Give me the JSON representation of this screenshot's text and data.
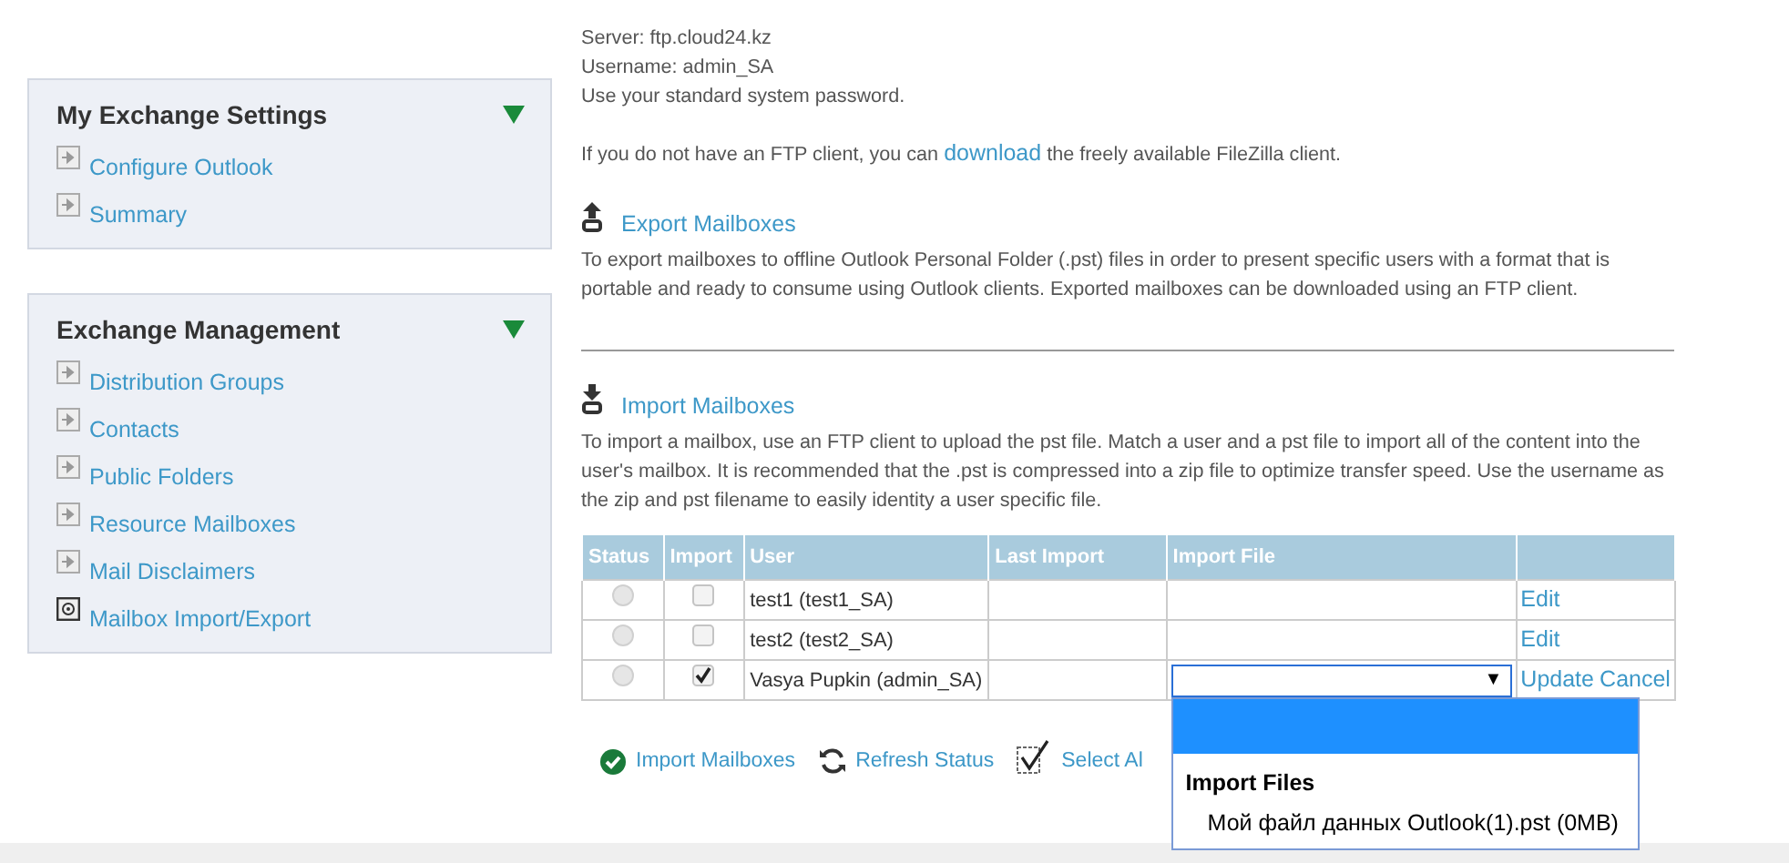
{
  "sidebar": {
    "panels": [
      {
        "title": "My Exchange Settings",
        "expanded": true,
        "items": [
          {
            "label": "Configure Outlook",
            "selected": false
          },
          {
            "label": "Summary",
            "selected": false
          }
        ]
      },
      {
        "title": "Exchange Management",
        "expanded": true,
        "items": [
          {
            "label": "Distribution Groups",
            "selected": false
          },
          {
            "label": "Contacts",
            "selected": false
          },
          {
            "label": "Public Folders",
            "selected": false
          },
          {
            "label": "Resource Mailboxes",
            "selected": false
          },
          {
            "label": "Mail Disclaimers",
            "selected": false
          },
          {
            "label": "Mailbox Import/Export",
            "selected": true
          }
        ]
      }
    ]
  },
  "ftp_login": {
    "lines": [
      "Server: ftp.cloud24.kz",
      "Username: admin_SA",
      "Use your standard system password."
    ],
    "download_note": {
      "before": "If you do not have an FTP client, you can ",
      "link": "download",
      "after": " the freely available FileZilla client."
    }
  },
  "export": {
    "title": "Export Mailboxes",
    "description": "To export mailboxes to offline Outlook Personal Folder (.pst) files in order to present specific users with a format that is portable and ready to consume using Outlook clients. Exported mailboxes can be downloaded using an FTP client."
  },
  "import": {
    "title": "Import Mailboxes",
    "description": "To import a mailbox, use an FTP client to upload the pst file. Match a user and a pst file to import all of the content into the user's mailbox. It is recommended that the .pst is compressed into a zip file to optimize transfer speed. Use the username as the zip and pst filename to easily identity a user specific file."
  },
  "table": {
    "columns": [
      "Status",
      "Import",
      "User",
      "Last Import",
      "Import File"
    ],
    "rows": [
      {
        "kind": "view",
        "import": false,
        "user": "test1 (test1_SA)",
        "actions": [
          "Edit"
        ]
      },
      {
        "kind": "view",
        "import": false,
        "user": "test2 (test2_SA)",
        "actions": [
          "Edit"
        ]
      },
      {
        "kind": "edit",
        "import": true,
        "user": "Vasya Pupkin (admin_SA)",
        "actions": [
          "Update",
          "Cancel"
        ]
      }
    ]
  },
  "dropdown": {
    "caret": "▼",
    "blank_option": {
      "selected": true
    },
    "group_label": "Import Files",
    "options": [
      {
        "label": "Мой файл данных Outlook(1).pst (0MB)",
        "selected": false
      }
    ]
  },
  "actions": [
    {
      "kind": "import",
      "label": "Import Mailboxes"
    },
    {
      "kind": "refresh",
      "label": "Refresh Status"
    },
    {
      "kind": "select",
      "label": "Select Al"
    }
  ]
}
